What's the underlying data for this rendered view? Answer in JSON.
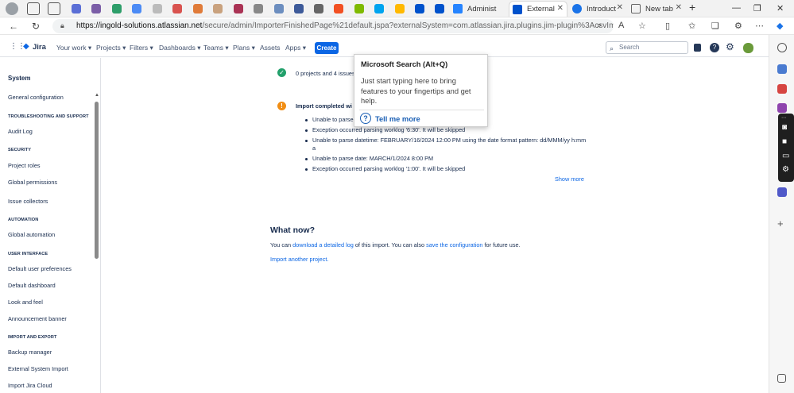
{
  "browser": {
    "tabs": [
      {
        "label": "Administ",
        "color": "#2684ff"
      },
      {
        "label": "External",
        "color": "#0052cc"
      },
      {
        "label": "Introduct",
        "color": "#1a73e8"
      },
      {
        "label": "New tab",
        "color": "#666666"
      }
    ],
    "url_host": "https://ingold-solutions.atlassian.net",
    "url_path": "/secure/admin/ImporterFinishedPage%21default.jspa?externalSystem=com.atlassian.jira.plugins.jim-plugin%3AcsvImporter..."
  },
  "jira": {
    "logo": "Jira",
    "nav": [
      "Your work",
      "Projects",
      "Filters",
      "Dashboards",
      "Teams",
      "Plans",
      "Assets",
      "Apps"
    ],
    "create": "Create",
    "search_placeholder": "Search"
  },
  "sidebar": {
    "title": "System",
    "items": {
      "general": "General configuration",
      "sec_troubleshooting": "TROUBLESHOOTING AND SUPPORT",
      "audit": "Audit Log",
      "sec_security": "SECURITY",
      "roles": "Project roles",
      "perms": "Global permissions",
      "collectors": "Issue collectors",
      "sec_automation": "AUTOMATION",
      "global_auto": "Global automation",
      "sec_ui": "USER INTERFACE",
      "user_prefs": "Default user preferences",
      "dashboard": "Default dashboard",
      "look": "Look and feel",
      "banner": "Announcement banner",
      "sec_import": "IMPORT AND EXPORT",
      "backup": "Backup manager",
      "ext_import": "External System Import",
      "cloud_import": "Import Jira Cloud"
    }
  },
  "main": {
    "summary": "0 projects and 4 issues",
    "warning_title": "Import completed wi",
    "messages": [
      "Unable to parse",
      "Exception occurred parsing worklog '6:30'. It will be skipped",
      "Unable to parse datetime: FEBRUARY/16/2024 12:00 PM using the date format pattern: dd/MMM/yy h:mm",
      "a",
      "Unable to parse date: MARCH/1/2024 8:00 PM",
      "Exception occurred parsing worklog '1:00'. It will be skipped"
    ],
    "show_more": "Show more",
    "what_now": "What now?",
    "line1_a": "You can ",
    "line1_link1": "download a detailed log",
    "line1_b": " of this import. You can also ",
    "line1_link2": "save the configuration",
    "line1_c": " for future use.",
    "import_another": "Import another project."
  },
  "tooltip": {
    "title": "Microsoft Search (Alt+Q)",
    "body": "Just start typing here to bring features to your fingertips and get help.",
    "link": "Tell me more"
  }
}
